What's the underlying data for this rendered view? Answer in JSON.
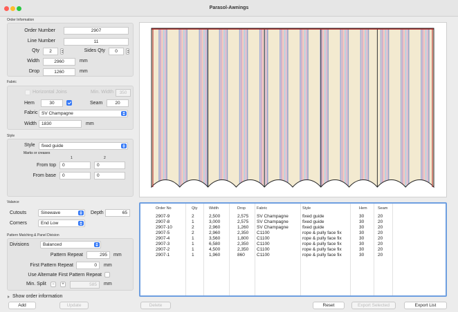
{
  "window": {
    "title": "Parasol-Awnings"
  },
  "order": {
    "section": "Order Information",
    "order_number_label": "Order Number",
    "order_number": "2907",
    "line_number_label": "Line Number",
    "line_number": "11",
    "qty_label": "Qty",
    "qty": "2",
    "sides_qty_label": "Sides Qty",
    "sides_qty": "0",
    "width_label": "Width",
    "width": "2960",
    "width_unit": "mm",
    "drop_label": "Drop",
    "drop": "1260",
    "drop_unit": "mm"
  },
  "fabric": {
    "section": "Fabric",
    "horizontal_joins_label": "Horizontal Joins",
    "min_width_label": "Min. Width",
    "min_width": "350",
    "hem_label": "Hem",
    "hem": "30",
    "seam_label": "Seam",
    "seam": "20",
    "fabric_label": "Fabric",
    "fabric": "SV Champagne",
    "width_label": "Width",
    "width": "1830",
    "width_unit": "mm"
  },
  "style": {
    "section": "Style",
    "style_label": "Style",
    "style": "fixed guide",
    "marks_label": "Marks or creases",
    "col1": "1",
    "col2": "2",
    "from_top_label": "From top",
    "from_top_1": "0",
    "from_top_2": "0",
    "from_base_label": "From base",
    "from_base_1": "0",
    "from_base_2": "0"
  },
  "valance": {
    "section": "Valance",
    "cutouts_label": "Cutouts",
    "cutouts": "Sinewave",
    "depth_label": "Depth",
    "depth": "65",
    "corners_label": "Corners",
    "corners": "End Low"
  },
  "pattern": {
    "section": "Pattern Matching & Panel Division",
    "divisions_label": "Divisions",
    "divisions": "Balanced",
    "pattern_repeat_label": "Pattern Repeat",
    "pattern_repeat": "295",
    "pattern_repeat_unit": "mm",
    "first_repeat_label": "First Pattern Repeat",
    "first_repeat": "0",
    "first_repeat_unit": "mm",
    "alt_label": "Use Alternate First Pattern Repeat",
    "min_split_label": "Min. Split",
    "minus": "−",
    "plus": "+",
    "min_split": "585",
    "min_split_unit": "mm"
  },
  "show_order_info": "Show order information",
  "buttons": {
    "add": "Add",
    "update": "Update",
    "delete": "Delete",
    "reset": "Reset",
    "export_selected": "Export Selected",
    "export_list": "Export List"
  },
  "table": {
    "headers": [
      "Order No",
      "Qty",
      "Width",
      "Drop",
      "Fabric",
      "Style",
      "Hem",
      "Seam"
    ],
    "rows": [
      [
        "2907-9",
        "2",
        "2,500",
        "2,575",
        "SV Champagne",
        "fixed guide",
        "30",
        "20"
      ],
      [
        "2907-8",
        "1",
        "3,000",
        "2,575",
        "SV Champagne",
        "fixed guide",
        "30",
        "20"
      ],
      [
        "2907-10",
        "2",
        "2,960",
        "1,260",
        "SV Champagne",
        "fixed guide",
        "30",
        "20"
      ],
      [
        "2907-5",
        "2",
        "2,960",
        "2,350",
        "C1100",
        "rope & pully face fix",
        "30",
        "20"
      ],
      [
        "2907-4",
        "1",
        "3,560",
        "1,800",
        "C1100",
        "rope & pully face fix",
        "30",
        "20"
      ],
      [
        "2907-3",
        "1",
        "6,580",
        "2,350",
        "C1100",
        "rope & pully face fix",
        "30",
        "20"
      ],
      [
        "2907-2",
        "1",
        "4,500",
        "2,350",
        "C1100",
        "rope & pully face fix",
        "30",
        "20"
      ],
      [
        "2907-1",
        "1",
        "1,960",
        "860",
        "C1100",
        "rope & pully face fix",
        "30",
        "20"
      ]
    ]
  },
  "preview": {
    "fabric_color": "#f3ead0",
    "stripe_colors": [
      "#9aa6d6",
      "#c79ac8",
      "#f1b8b8",
      "#a7c7e2",
      "#d7a8d2",
      "#8c97c9"
    ],
    "outline_color": "#b22222",
    "panels": 5,
    "waves": 10
  }
}
